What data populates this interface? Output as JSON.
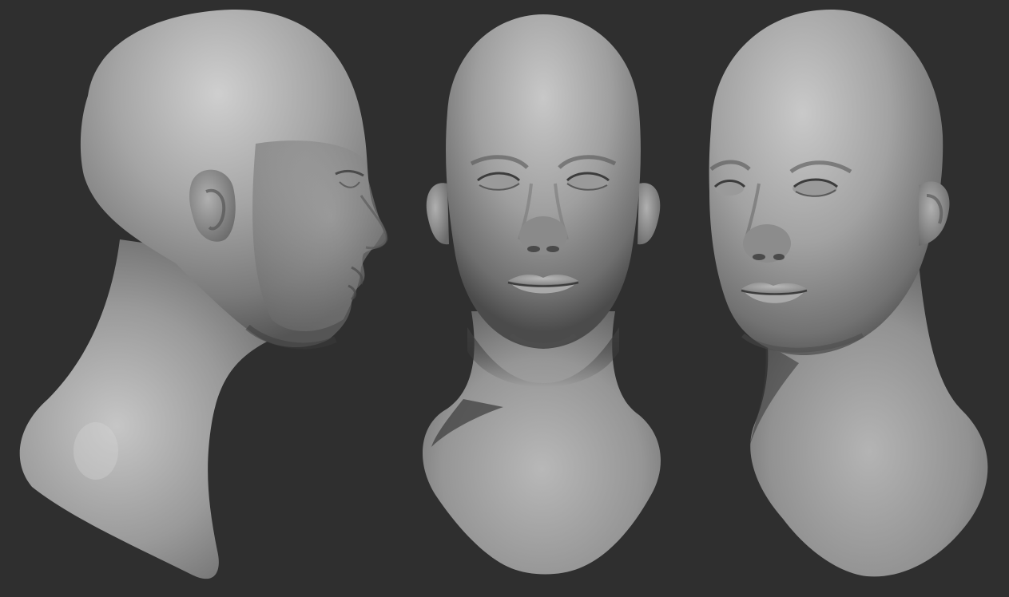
{
  "scene": {
    "background_color": "#2f2f2f",
    "material_light": "#c9c9c9",
    "material_mid": "#8e8e8e",
    "material_dark": "#3a3a3a",
    "views": [
      {
        "name": "head-side-view",
        "angle": "profile-right"
      },
      {
        "name": "head-front-view",
        "angle": "front"
      },
      {
        "name": "head-three-quarter-view",
        "angle": "three-quarter-left"
      }
    ]
  }
}
